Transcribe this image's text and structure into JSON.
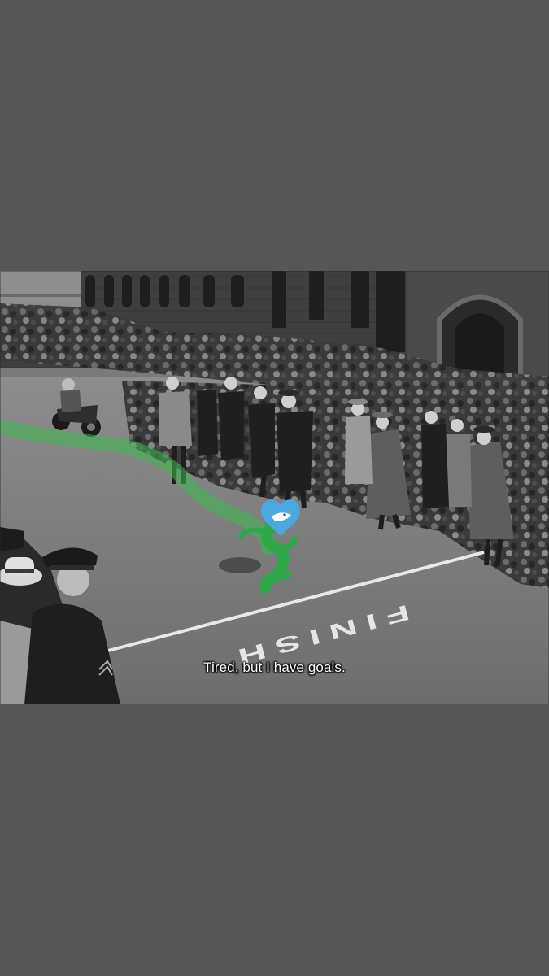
{
  "photo": {
    "road_marking": "FINISH",
    "caption": "Tired, but I have goals."
  },
  "colors": {
    "background": "#565656",
    "character_green": "#2fa84a",
    "heart_blue": "#4aa8e0",
    "trail_green": "#3cb94f"
  },
  "icons": {
    "character": "green-runner-heart-head-icon"
  }
}
